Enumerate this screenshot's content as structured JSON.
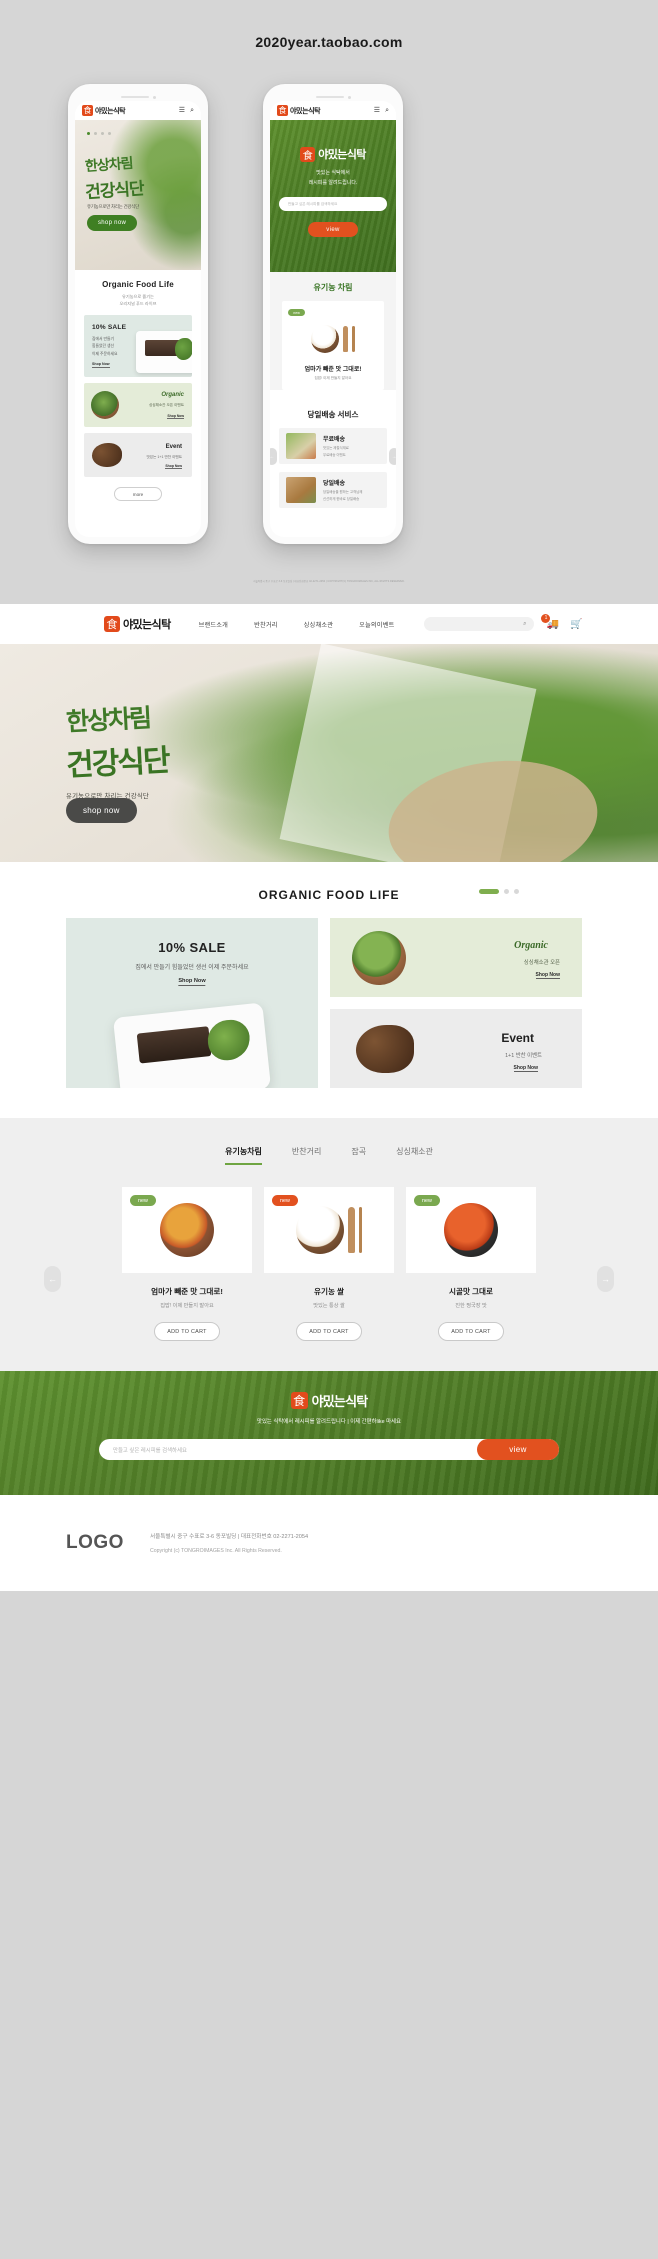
{
  "topbar": {
    "url": "2020year.taobao.com"
  },
  "brand": {
    "mark": "食",
    "word": "야밌는식탁",
    "accent_orange": "#e2511f",
    "accent_green": "#3f7f23"
  },
  "mobile": {
    "phone1": {
      "header": {
        "menu_icon": "hamburger-icon",
        "search_icon": "search-icon"
      },
      "hero": {
        "line1": "한상차림",
        "line2": "건강식단",
        "sub": "유기농으로만 차리는 건강식단",
        "cta": "shop now",
        "dots": 4,
        "active_dot": 1
      },
      "section": {
        "title": "Organic Food Life",
        "sub_line1": "유기농으로 즐기는",
        "sub_line2": "오리지널 푸드 라이프"
      },
      "cards": [
        {
          "title": "10% SALE",
          "d1": "집에서 만들기",
          "d2": "힘들었던 생선",
          "d3": "이제 주문하세요",
          "link": "Shop Now"
        },
        {
          "title": "Organic",
          "d1": "싱싱채소관 오픈 이벤트",
          "link": "Shop Now"
        },
        {
          "title": "Event",
          "d1": "맛있는 1+1 반찬 이벤트",
          "link": "Shop Now"
        }
      ],
      "more": "more"
    },
    "phone2": {
      "hero": {
        "sub_line1": "맛있는 식탁에서",
        "sub_line2": "레시피를 알려드립니다.",
        "search_placeholder": "만들고 싶은 레시피를 검색하세요",
        "cta": "view"
      },
      "organic": {
        "title": "유기농 차림",
        "badge": "new",
        "product_title": "엄마가 빼준 맛 그대로!",
        "product_desc": "집밥! 이제 만들지 말아요",
        "prev": "←",
        "next": "→"
      },
      "delivery": {
        "title": "당일배송 서비스",
        "items": [
          {
            "title": "무료배송",
            "d1": "맛있는 제철식재료",
            "d2": "무료배송 이벤트"
          },
          {
            "title": "당일배송",
            "d1": "당일배송을 원하는 고객님께",
            "d2": "신선하게 한바로 당일배송"
          }
        ]
      }
    },
    "legal": "서울특별시 중구 수표로 3-6 동포빌딩 | 대표전화번호 02-2271-2054 | COPYRIGHT(C) TONGROIMAGES INC, ALL RIGHTS RESERVED."
  },
  "desktop": {
    "nav": {
      "menu": [
        "브랜드소개",
        "반찬거리",
        "싱싱채소관",
        "오늘의이벤트"
      ],
      "search_placeholder": "",
      "search_icon": "search-icon",
      "delivery_icon": "truck-icon",
      "cart_icon": "cart-icon",
      "cart_badge": "1"
    },
    "hero": {
      "line1": "한상차림",
      "line2": "건강식단",
      "sub": "유기농으로만 차리는 건강식단",
      "cta": "shop now"
    },
    "organic_section": {
      "title": "ORGANIC FOOD LIFE",
      "cards": {
        "sale": {
          "title": "10% SALE",
          "desc": "집에서 만들기 힘들었던 생선 이제 주문하세요",
          "link": "Shop Now"
        },
        "organic": {
          "title": "Organic",
          "desc": "싱싱채소관 오픈",
          "link": "Shop Now"
        },
        "event": {
          "title": "Event",
          "desc": "1+1 반찬 이벤트",
          "link": "Shop Now"
        }
      }
    },
    "products_section": {
      "tabs": [
        "유기농차림",
        "반찬거리",
        "잡곡",
        "싱싱채소관"
      ],
      "active_tab": "유기농차림",
      "prev": "←",
      "next": "→",
      "items": [
        {
          "badge": "new",
          "badge_color": "green",
          "title": "엄마가 빼준 맛 그대로!",
          "desc": "집밥! 이제 만들지 말아요",
          "cta": "ADD TO CART"
        },
        {
          "badge": "new",
          "badge_color": "orange",
          "title": "유기농 쌀",
          "desc": "맛있는 통상 쌀",
          "cta": "ADD TO CART"
        },
        {
          "badge": "new",
          "badge_color": "green",
          "title": "시골맛 그대로",
          "desc": "진한 찡국장 맛",
          "cta": "ADD TO CART"
        }
      ]
    },
    "newsletter": {
      "sub": "맛있는 식탁에서 레시피를 알려드립니다 | 이제 간편하like 마세요",
      "placeholder": "만들고 싶은 레시피를 검색하세요",
      "cta": "view"
    },
    "footer": {
      "logo": "LOGO",
      "line1": "서울특별시 중구 수표로 3-6 동포빌딩  |  대표전화번호 02-2271-2054",
      "line2": "Copyright (c) TONGROIMAGES Inc. All Rights Reserved."
    }
  }
}
